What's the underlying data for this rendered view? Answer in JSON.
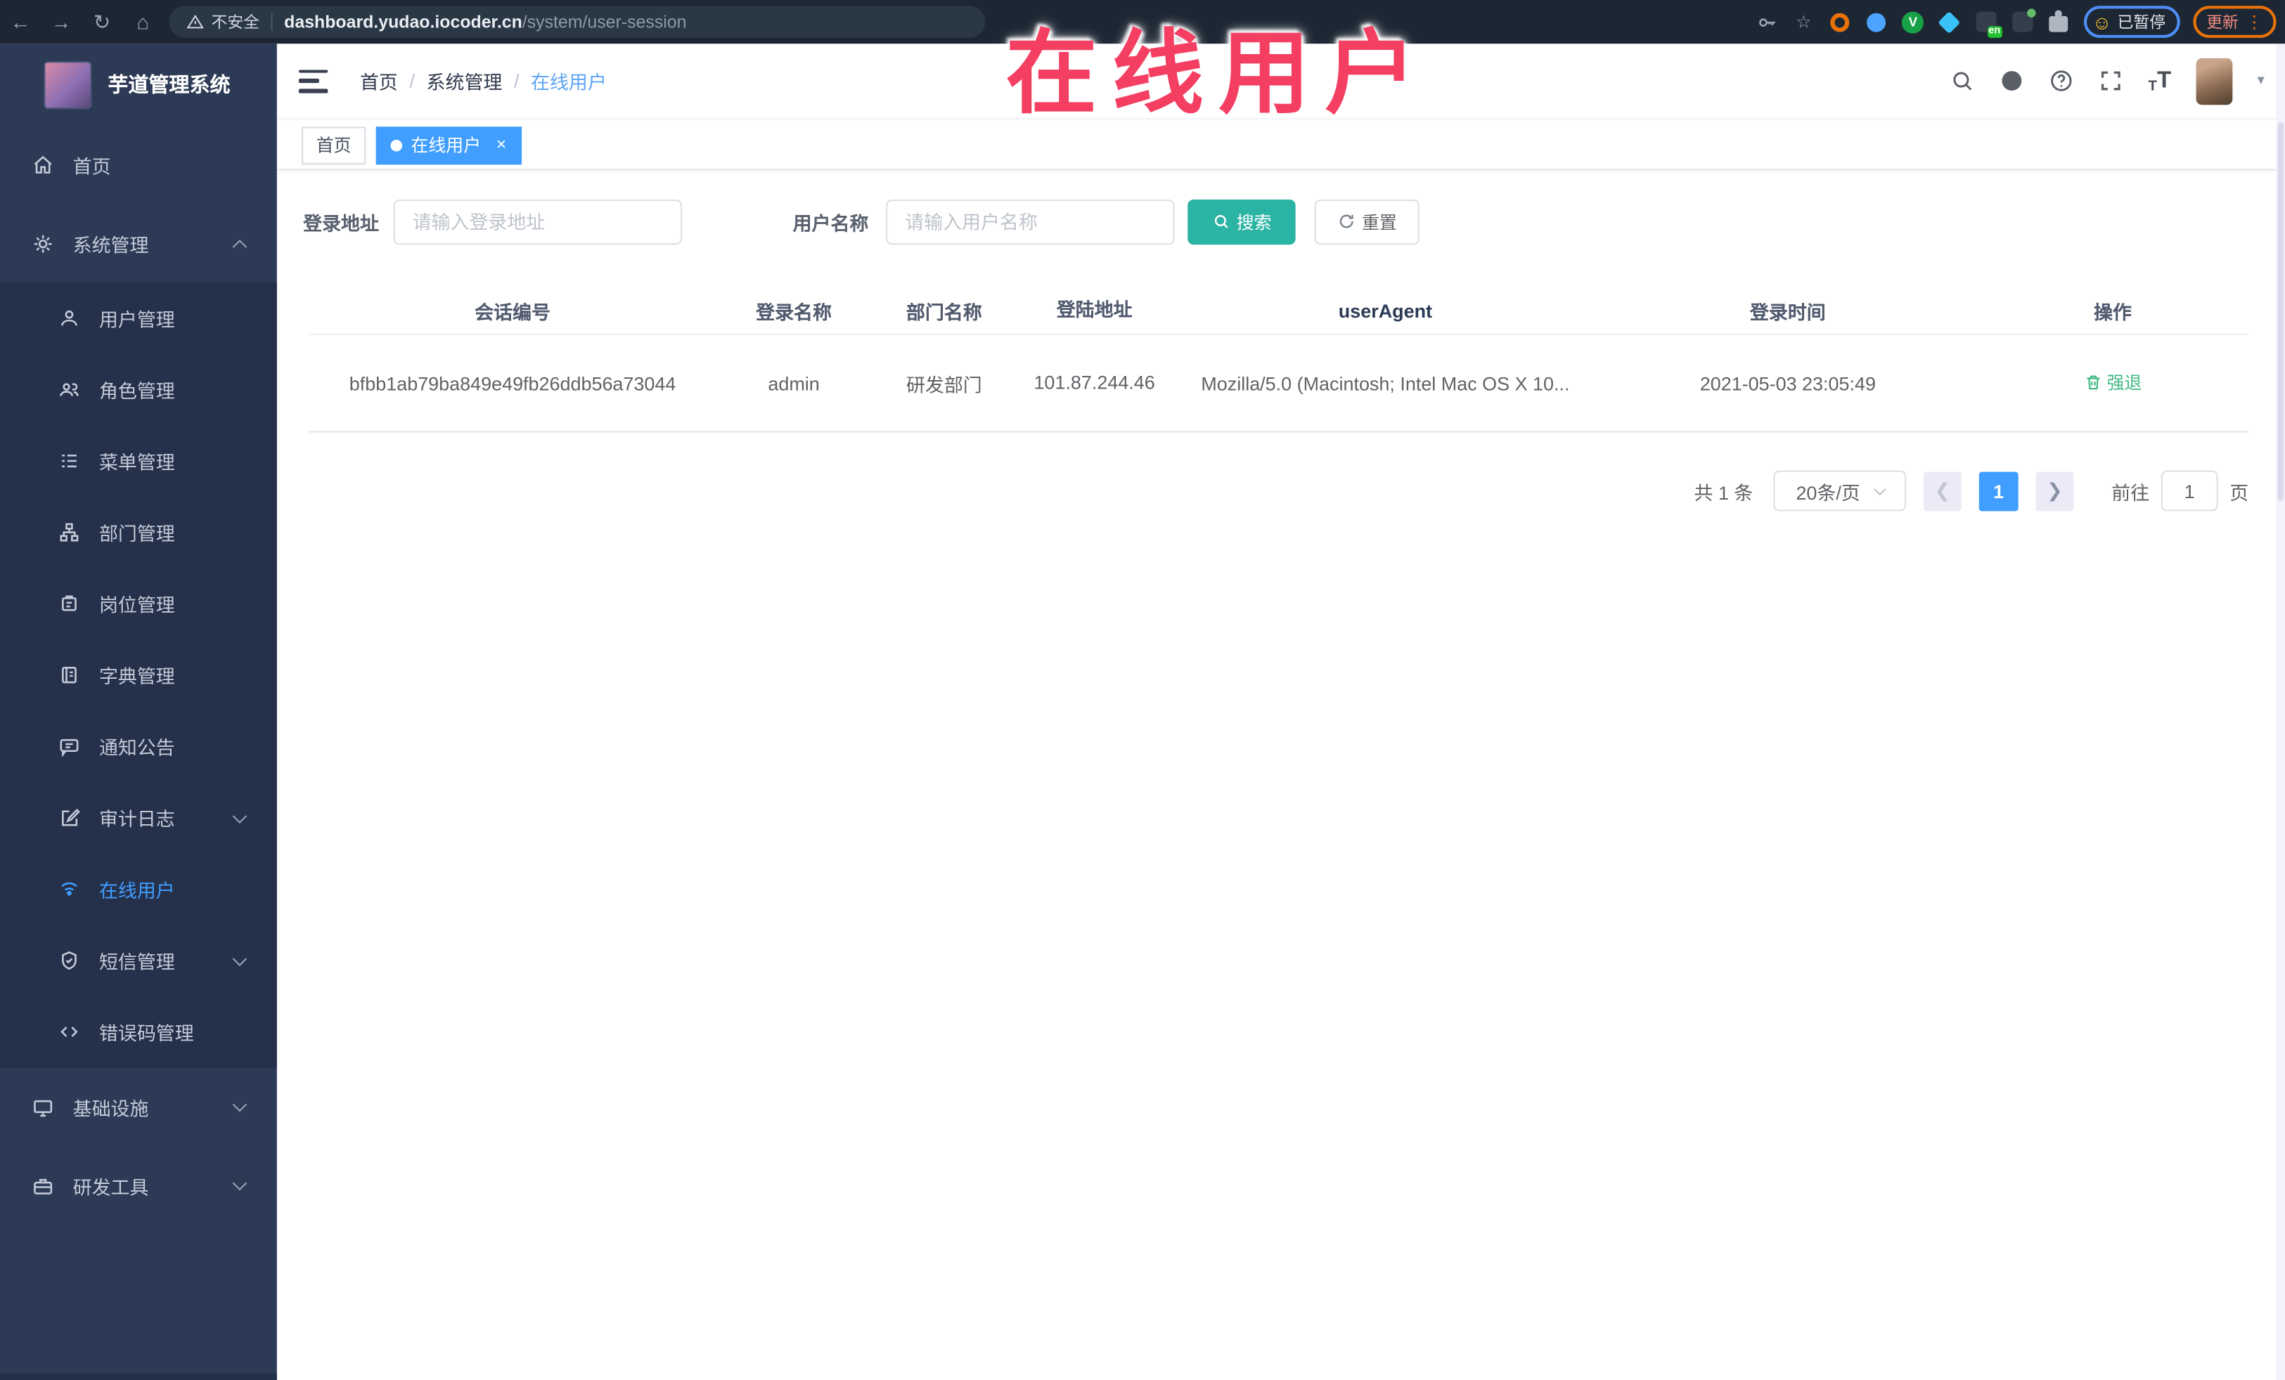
{
  "browser": {
    "security_label": "不安全",
    "url_host": "dashboard.yudao.iocoder.cn",
    "url_path": "/system/user-session",
    "ext_badge": "en",
    "ext_v": "V",
    "paused_badge": "已暂停",
    "update_label": "更新"
  },
  "glyphs": {
    "back": "←",
    "forward": "→",
    "reload": "↻",
    "home": "⌂",
    "star": "☆",
    "kebab": "⋮",
    "emoji": "☺",
    "dot": "●",
    "close": "×",
    "separator": "/",
    "caret": "▾",
    "font_size": "T"
  },
  "annotation": {
    "title": "在线用户",
    "color": "#f43f63"
  },
  "sidebar": {
    "logo_title": "芋道管理系统",
    "menu": [
      {
        "label": "首页",
        "icon": "home-icon"
      },
      {
        "label": "系统管理",
        "icon": "gear-icon",
        "caret": "up"
      },
      {
        "label": "用户管理",
        "icon": "user-icon"
      },
      {
        "label": "角色管理",
        "icon": "users-icon"
      },
      {
        "label": "菜单管理",
        "icon": "menu-list-icon"
      },
      {
        "label": "部门管理",
        "icon": "org-tree-icon"
      },
      {
        "label": "岗位管理",
        "icon": "badge-icon"
      },
      {
        "label": "字典管理",
        "icon": "book-icon"
      },
      {
        "label": "通知公告",
        "icon": "chat-icon"
      },
      {
        "label": "审计日志",
        "icon": "edit-icon",
        "caret": "down"
      },
      {
        "label": "在线用户",
        "icon": "online-icon",
        "active": true
      },
      {
        "label": "短信管理",
        "icon": "shield-icon",
        "caret": "down"
      },
      {
        "label": "错误码管理",
        "icon": "code-icon"
      },
      {
        "label": "基础设施",
        "icon": "monitor-icon",
        "caret": "down"
      },
      {
        "label": "研发工具",
        "icon": "briefcase-icon",
        "caret": "down"
      }
    ]
  },
  "header": {
    "breadcrumbs": [
      "首页",
      "系统管理",
      "在线用户"
    ]
  },
  "tabs": [
    {
      "label": "首页",
      "active": false
    },
    {
      "label": "在线用户",
      "active": true
    }
  ],
  "filters": {
    "login_address_label": "登录地址",
    "login_address_placeholder": "请输入登录地址",
    "username_label": "用户名称",
    "username_placeholder": "请输入用户名称",
    "search_label": "搜索",
    "reset_label": "重置"
  },
  "table": {
    "columns": [
      "会话编号",
      "登录名称",
      "部门名称",
      "登陆地址",
      "userAgent",
      "登录时间",
      "操作"
    ],
    "rows": [
      {
        "session_id": "bfbb1ab79ba849e49fb26ddb56a73044",
        "username": "admin",
        "dept": "研发部门",
        "ip": "101.87.244.46",
        "user_agent": "Mozilla/5.0 (Macintosh; Intel Mac OS X 10...",
        "login_time": "2021-05-03 23:05:49",
        "action": "强退"
      }
    ]
  },
  "pagination": {
    "total_text": "共 1 条",
    "page_size": "20条/页",
    "current_page": "1",
    "goto_label": "前往",
    "goto_value": "1",
    "page_unit": "页"
  },
  "colors": {
    "accent": "#409eff",
    "search_teal": "#2bb3a3",
    "action_green": "#42b983",
    "annotation_pink": "#f43f63"
  }
}
